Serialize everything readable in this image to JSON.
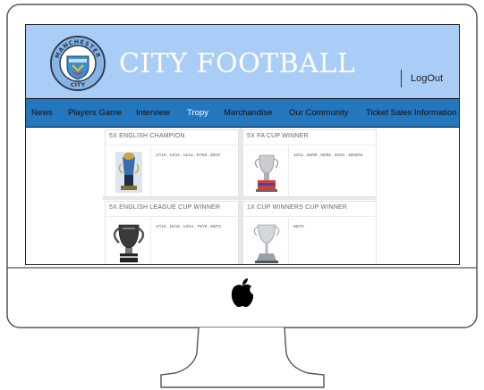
{
  "header": {
    "title": "CITY FOOTBALL",
    "logout_label": "LogOut",
    "logo": {
      "ring_text": "MANCHESTER",
      "bottom_text": "CITY"
    }
  },
  "nav": {
    "items": [
      {
        "label": "News"
      },
      {
        "label": "Players Game"
      },
      {
        "label": "Interview"
      },
      {
        "label": "Tropy"
      },
      {
        "label": "Marchandise"
      },
      {
        "label": "Our Community"
      },
      {
        "label": "Ticket Sales Information"
      }
    ],
    "active_index": 3
  },
  "trophies": [
    {
      "title": "5X ENGLISH CHAMPION",
      "years": "17/18 , 13/14 , 11/12 , 67/68 , 36/37",
      "icon": "premier-league-trophy-icon"
    },
    {
      "title": "5X FA CUP WINNER",
      "years": "10/11 , 68/69 , 55/56 , 33/34 , 1903/04",
      "icon": "fa-cup-trophy-icon"
    },
    {
      "title": "5X ENGLISH LEAGUE CUP WINNER",
      "years": "17/18 , 15/16 , 13/14 , 75/76 , 69/70",
      "icon": "league-cup-trophy-icon"
    },
    {
      "title": "1X CUP WINNERS CUP WINNER",
      "years": "69/70",
      "icon": "cup-winners-cup-trophy-icon"
    }
  ],
  "colors": {
    "header_bg": "#a9cdf7",
    "nav_bg": "#2476bd",
    "active_nav": "#ffffff"
  }
}
